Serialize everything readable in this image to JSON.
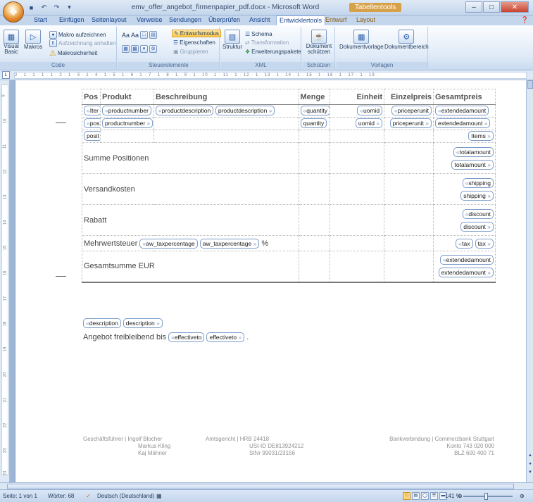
{
  "window": {
    "title": "emv_offer_angebot_firmenpapier_pdf.docx - Microsoft Word",
    "context_tab_group": "Tabellentools"
  },
  "ribbon_tabs": [
    "Start",
    "Einfügen",
    "Seitenlayout",
    "Verweise",
    "Sendungen",
    "Überprüfen",
    "Ansicht",
    "Entwicklertools",
    "Entwurf",
    "Layout"
  ],
  "active_tab": "Entwicklertools",
  "ribbon": {
    "code": {
      "label": "Code",
      "visual_basic": "Visual Basic",
      "makros": "Makros",
      "makro_aufzeichnen": "Makro aufzeichnen",
      "aufzeichnung_anhalten": "Aufzeichnung anhalten",
      "makrosicherheit": "Makrosicherheit"
    },
    "steuerelemente": {
      "label": "Steuerelemente",
      "entwurfsmodus": "Entwurfsmodus",
      "eigenschaften": "Eigenschaften",
      "gruppieren": "Gruppieren",
      "aa": "Aa Aa"
    },
    "xml": {
      "label": "XML",
      "struktur": "Struktur",
      "schema": "Schema",
      "transformation": "Transformation",
      "erweiterungspakete": "Erweiterungspakete"
    },
    "schuetzen": {
      "label": "Schützen",
      "dokument_schuetzen": "Dokument schützen"
    },
    "vorlagen": {
      "label": "Vorlagen",
      "dokumentvorlage": "Dokumentvorlage",
      "dokumentbereich": "Dokumentbereich"
    }
  },
  "ruler_text": "2 · 1 · 1 · 1 · 1 · 2 · 1 · 3 · 1 · 4 · 1 · 5 · 1 · 6 · 1 · 7 · 1 · 8 · 1 · 9 · 1 · 10 · 1 · 11 · 1 · 12 · 1 · 13 · 1 · 14 · 1 · 15 · 1 · 16 · 1 · 17 · 1 · 18 ·",
  "vruler_numbers": [
    "9",
    "10",
    "11",
    "12",
    "13",
    "14",
    "15",
    "16",
    "17",
    "18",
    "19",
    "20",
    "21",
    "22",
    "23",
    "24"
  ],
  "table": {
    "headers": [
      "Pos",
      "Produkt",
      "Beschreibung",
      "Menge",
      "Einheit",
      "Einzelpreis",
      "Gesamtpreis"
    ],
    "row1": [
      "Iter",
      "productnumber",
      "productdescription",
      "productdescription",
      "quantity",
      "uomid",
      "priceperunit",
      "extendedamount"
    ],
    "row2": [
      "pos",
      "productnumber",
      "quantity",
      "uomid",
      "priceperunit",
      "extendedamount"
    ],
    "row3": [
      "posit",
      "Items"
    ],
    "summe": {
      "label": "Summe Positionen",
      "tag_start": "totalamount",
      "tag_end": "totalamount"
    },
    "versand": {
      "label": "Versandkosten",
      "tag_start": "shipping",
      "tag_end": "shipping"
    },
    "rabatt": {
      "label": "Rabatt",
      "tag_start": "discount",
      "tag_end": "discount"
    },
    "mwst": {
      "label": "Mehrwertsteuer",
      "pct_start": "aw_taxpercentage",
      "pct_end": "aw_taxpercentage",
      "pct_sign": "%",
      "tax_start": "tax",
      "tax_end": "tax"
    },
    "gesamt": {
      "label": "Gesamtsumme EUR",
      "tag_start": "extendedamount",
      "tag_end": "extendedamount"
    }
  },
  "body": {
    "desc_start": "description",
    "desc_end": "description",
    "angebot_text": "Angebot freibleibend bis",
    "eff_start": "effectiveto",
    "eff_end": "effectiveto",
    "period": "."
  },
  "footer": {
    "gf_label": "Geschäftsführer | Ingolf Blocher",
    "gf_2": "Markus Kling",
    "gf_3": "Kaj Mähner",
    "ag_label": "Amtsgericht | HRB 24418",
    "ustid": "USt-ID DE813924212",
    "stnr": "StNr 99031/23156",
    "bank_label": "Bankverbindung | Commerzbank Stuttgart",
    "konto": "Konto 743 020 000",
    "blz": "BLZ 600 400 71"
  },
  "status": {
    "seite": "Seite: 1 von 1",
    "woerter": "Wörter: 68",
    "sprache": "Deutsch (Deutschland)",
    "zoom": "141 %"
  }
}
